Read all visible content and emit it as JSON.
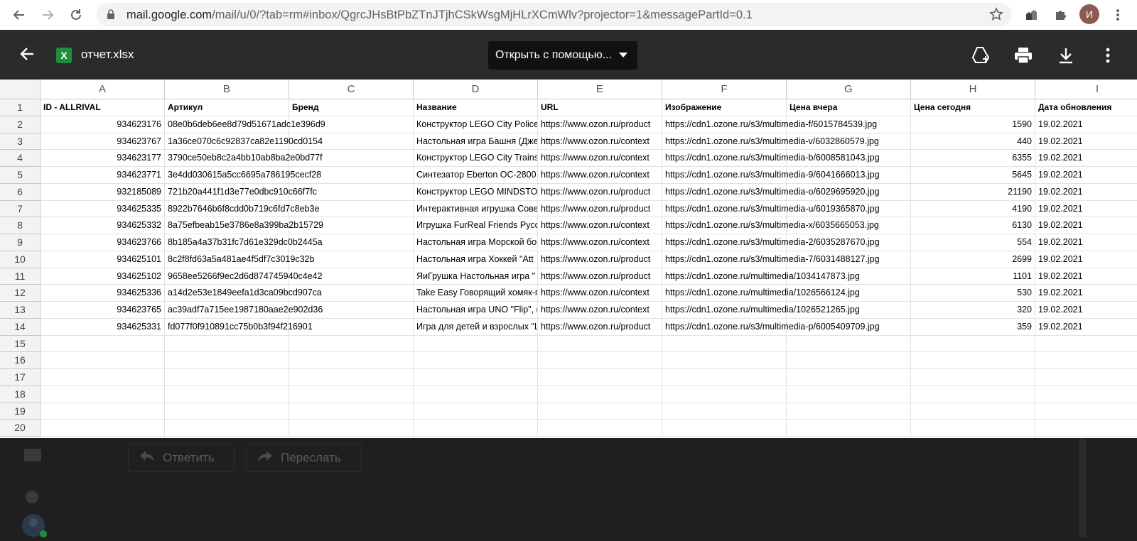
{
  "browser": {
    "url_host": "mail.google.com",
    "url_rest": "/mail/u/0/?tab=rm#inbox/QgrcJHsBtPbZTnJTjhCSkWsgMjHLrXCmWlv?projector=1&messagePartId=0.1",
    "avatar_letter": "И"
  },
  "viewer": {
    "file_name": "отчет.xlsx",
    "file_icon_letter": "X",
    "open_with_label": "Открыть с помощью..."
  },
  "sheet": {
    "columns": [
      "A",
      "B",
      "C",
      "D",
      "E",
      "F",
      "G",
      "H",
      "I"
    ],
    "row_numbers": [
      "1",
      "2",
      "3",
      "4",
      "5",
      "6",
      "7",
      "8",
      "9",
      "10",
      "11",
      "12",
      "13",
      "14",
      "15",
      "16",
      "17",
      "18",
      "19",
      "20"
    ],
    "headers": [
      "ID - ALLRIVAL",
      "Артикул",
      "Бренд",
      "Название",
      "URL",
      "Изображение",
      "Цена вчера",
      "Цена сегодня",
      "Дата обновления"
    ],
    "rows": [
      {
        "id": "934623176",
        "sku": "08e0b6deb6ee8d79d51671adc1e396d9",
        "name": "Конструктор LEGO City Police",
        "url": "https://www.ozon.ru/product",
        "image": "https://cdn1.ozone.ru/s3/multimedia-f/6015784539.jpg",
        "price_today": "1590",
        "date": "19.02.2021"
      },
      {
        "id": "934623767",
        "sku": "1a36ce070c6c92837ca82e1190cd0154",
        "name": "Настольная игра Башня (Дже",
        "url": "https://www.ozon.ru/context",
        "image": "https://cdn1.ozone.ru/s3/multimedia-v/6032860579.jpg",
        "price_today": "440",
        "date": "19.02.2021"
      },
      {
        "id": "934623177",
        "sku": "3790ce50eb8c2a4bb10ab8ba2e0bd77f",
        "name": "Конструктор LEGO City Trains",
        "url": "https://www.ozon.ru/context",
        "image": "https://cdn1.ozone.ru/s3/multimedia-b/6008581043.jpg",
        "price_today": "6355",
        "date": "19.02.2021"
      },
      {
        "id": "934623771",
        "sku": "3e4dd030615a5cc6695a786195cecf28",
        "name": "Синтезатор Eberton OC-2800",
        "url": "https://www.ozon.ru/context",
        "image": "https://cdn1.ozone.ru/s3/multimedia-9/6041666013.jpg",
        "price_today": "5645",
        "date": "19.02.2021"
      },
      {
        "id": "932185089",
        "sku": "721b20a441f1d3e77e0dbc910c66f7fc",
        "name": "Конструктор LEGO MINDSTOR",
        "url": "https://www.ozon.ru/product",
        "image": "https://cdn1.ozone.ru/s3/multimedia-o/6029695920.jpg",
        "price_today": "21190",
        "date": "19.02.2021"
      },
      {
        "id": "934625335",
        "sku": "8922b7646b6f8cdd0b719c6fd7c8eb3e",
        "name": "Интерактивная игрушка Сове",
        "url": "https://www.ozon.ru/product",
        "image": "https://cdn1.ozone.ru/s3/multimedia-u/6019365870.jpg",
        "price_today": "4190",
        "date": "19.02.2021"
      },
      {
        "id": "934625332",
        "sku": "8a75efbeab15e3786e8a399ba2b15729",
        "name": "Игрушка FurReal Friends Русс",
        "url": "https://www.ozon.ru/context",
        "image": "https://cdn1.ozone.ru/s3/multimedia-x/6035665053.jpg",
        "price_today": "6130",
        "date": "19.02.2021"
      },
      {
        "id": "934623766",
        "sku": "8b185a4a37b31fc7d61e329dc0b2445a",
        "name": "Настольная игра Морской бо",
        "url": "https://www.ozon.ru/context",
        "image": "https://cdn1.ozone.ru/s3/multimedia-2/6035287670.jpg",
        "price_today": "554",
        "date": "19.02.2021"
      },
      {
        "id": "934625101",
        "sku": "8c2f8fd63a5a481ae4f5df7c3019c32b",
        "name": "Настольная игра Хоккей \"Att",
        "url": "https://www.ozon.ru/product",
        "image": "https://cdn1.ozone.ru/s3/multimedia-7/6031488127.jpg",
        "price_today": "2699",
        "date": "19.02.2021"
      },
      {
        "id": "934625102",
        "sku": "9658ee5266f9ec2d6d874745940c4e42",
        "name": "ЯиГрушка Настольная игра \"",
        "url": "https://www.ozon.ru/product",
        "image": "https://cdn1.ozone.ru/multimedia/1034147873.jpg",
        "price_today": "1101",
        "date": "19.02.2021"
      },
      {
        "id": "934625336",
        "sku": "a14d2e53e1849eefa1d3ca09bcd907ca",
        "name": "Take Easy Говорящий хомяк-п",
        "url": "https://www.ozon.ru/context",
        "image": "https://cdn1.ozone.ru/multimedia/1026566124.jpg",
        "price_today": "530",
        "date": "19.02.2021"
      },
      {
        "id": "934623765",
        "sku": "ac39adf7a715ee1987180aae2e902d36",
        "name": "Настольная игра UNO \"Flip\", (",
        "url": "https://www.ozon.ru/context",
        "image": "https://cdn1.ozone.ru/multimedia/1026521265.jpg",
        "price_today": "320",
        "date": "19.02.2021"
      },
      {
        "id": "934625331",
        "sku": "fd077f0f910891cc75b0b3f94f216901",
        "name": "Игра для детей и взрослых \"L",
        "url": "https://www.ozon.ru/product",
        "image": "https://cdn1.ozone.ru/s3/multimedia-p/6005409709.jpg",
        "price_today": "359",
        "date": "19.02.2021"
      }
    ]
  },
  "mail": {
    "reply_label": "Ответить",
    "forward_label": "Переслать"
  },
  "icons": [
    "back-icon",
    "forward-icon",
    "reload-icon",
    "lock-icon",
    "star-icon",
    "extension-icon",
    "puzzle-icon",
    "arrow-left-icon",
    "spreadsheet-icon",
    "dropdown-caret-icon",
    "add-to-drive-icon",
    "print-icon",
    "download-icon",
    "more-vert-icon",
    "keyboard-icon",
    "reply-icon",
    "forward-mail-icon",
    "hangouts-icon",
    "contact-icon"
  ]
}
